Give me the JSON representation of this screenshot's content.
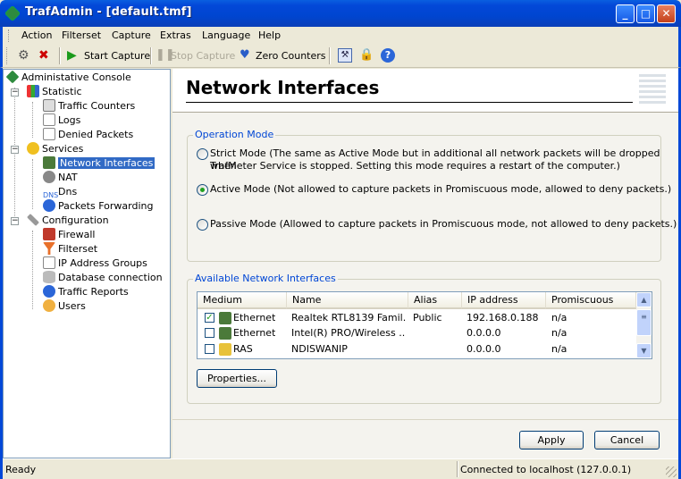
{
  "window": {
    "title": "TrafAdmin - [default.tmf]"
  },
  "menu": [
    "Action",
    "Filterset",
    "Capture",
    "Extras",
    "Language",
    "Help"
  ],
  "toolbar": {
    "start_capture": "Start Capture",
    "stop_capture": "Stop Capture",
    "zero_counters": "Zero Counters"
  },
  "tree": {
    "root": "Administative Console",
    "statistic": {
      "label": "Statistic",
      "children": [
        "Traffic Counters",
        "Logs",
        "Denied Packets"
      ]
    },
    "services": {
      "label": "Services",
      "children": [
        "Network Interfaces",
        "NAT",
        "Dns",
        "Packets Forwarding"
      ]
    },
    "configuration": {
      "label": "Configuration",
      "children": [
        "Firewall",
        "Filterset",
        "IP Address Groups",
        "Database connection",
        "Traffic Reports",
        "Users"
      ]
    }
  },
  "page": {
    "title": "Network Interfaces"
  },
  "operation_mode": {
    "legend": "Operation Mode",
    "strict_line1": "Strict Mode (The same as Active Mode but in additional all network packets will be dropped when",
    "strict_line2": "TrafMeter Service is stopped. Setting this mode requires a restart of the computer.)",
    "active": "Active Mode (Not allowed to capture packets in Promiscuous mode, allowed to deny packets.)",
    "passive": "Passive Mode (Allowed to capture packets in Promiscuous mode, not allowed to deny packets.)",
    "selected": "active"
  },
  "interfaces": {
    "legend": "Available Network Interfaces",
    "columns": [
      "Medium",
      "Name",
      "Alias",
      "IP address",
      "Promiscuous"
    ],
    "rows": [
      {
        "checked": true,
        "medium": "Ethernet",
        "name": "Realtek RTL8139 Famil...",
        "alias": "Public",
        "ip": "192.168.0.188",
        "promiscuous": "n/a"
      },
      {
        "checked": false,
        "medium": "Ethernet",
        "name": "Intel(R) PRO/Wireless ...",
        "alias": "",
        "ip": "0.0.0.0",
        "promiscuous": "n/a"
      },
      {
        "checked": false,
        "medium": "RAS",
        "name": "NDISWANIP",
        "alias": "",
        "ip": "0.0.0.0",
        "promiscuous": "n/a"
      }
    ],
    "properties_button": "Properties..."
  },
  "buttons": {
    "apply": "Apply",
    "cancel": "Cancel"
  },
  "status": {
    "left": "Ready",
    "right": "Connected to localhost (127.0.0.1)"
  }
}
